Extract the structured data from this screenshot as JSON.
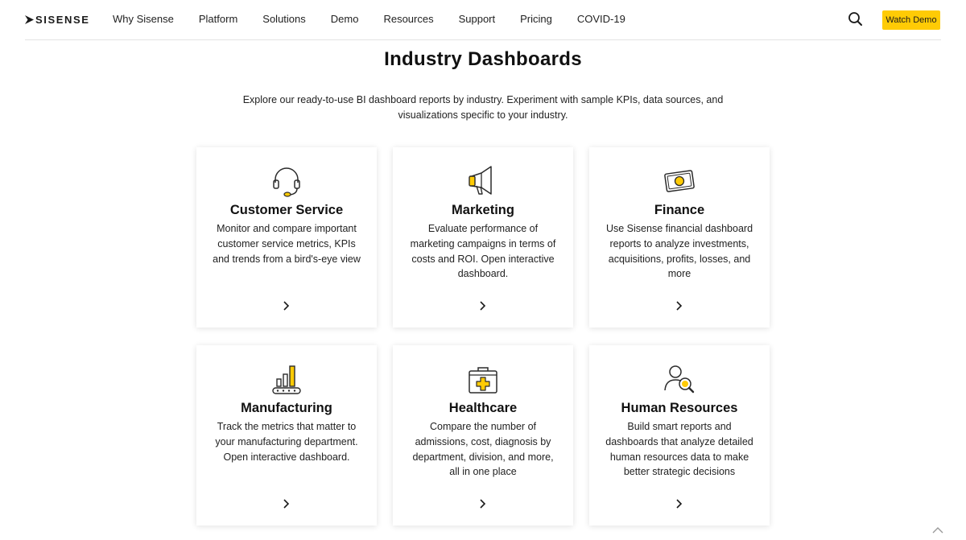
{
  "brand": {
    "name": "SISENSE"
  },
  "nav": {
    "links": [
      "Why Sisense",
      "Platform",
      "Solutions",
      "Demo",
      "Resources",
      "Support",
      "Pricing",
      "COVID-19"
    ],
    "watch_demo": "Watch Demo"
  },
  "page": {
    "title": "Industry Dashboards",
    "intro": "Explore our ready-to-use BI dashboard reports by industry. Experiment with sample KPIs, data sources, and visualizations specific to your industry."
  },
  "cards": [
    {
      "title": "Customer Service",
      "desc": "Monitor and compare important customer service metrics, KPIs and trends from a bird's-eye view",
      "icon": "headset-icon"
    },
    {
      "title": "Marketing",
      "desc": "Evaluate performance of marketing campaigns in terms of costs and ROI. Open interactive dashboard.",
      "icon": "megaphone-icon"
    },
    {
      "title": "Finance",
      "desc": "Use Sisense financial dashboard reports to analyze investments, acquisitions, profits, losses, and more",
      "icon": "banknote-icon"
    },
    {
      "title": "Manufacturing",
      "desc": "Track the metrics that matter to your manufacturing department. Open interactive dashboard.",
      "icon": "conveyor-chart-icon"
    },
    {
      "title": "Healthcare",
      "desc": "Compare the number of admissions, cost, diagnosis by department, division, and more, all in one place",
      "icon": "medical-kit-icon"
    },
    {
      "title": "Human Resources",
      "desc": "Build smart reports and dashboards that analyze detailed human resources data to make better strategic decisions",
      "icon": "person-search-icon"
    }
  ],
  "colors": {
    "accent": "#ffcb05",
    "text": "#1a1a1a",
    "divider": "#e3e3e3"
  }
}
